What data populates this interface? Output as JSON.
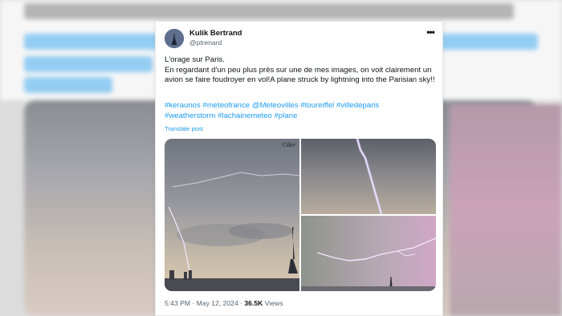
{
  "tweet": {
    "author_name": "Kulik Bertrand",
    "author_handle": "@ptrenard",
    "line1": "L'orage sur Paris.",
    "line2": "En regardant d'un peu plus près sur une de mes images, on voit clairement un avion se faire foudroyer en vol!A plane struck by lightning into the Parisian sky!!",
    "hashtags": [
      "#keraunos",
      "#meteofrance",
      "@Meteovilles",
      "#toureiffel",
      "#villedeparis",
      "#weatherstorm",
      "#lachainemeteo",
      "#plane"
    ],
    "translate_label": "Translate post",
    "photo_watermark": "©Ber",
    "time": "5:43 PM",
    "date": "May 12, 2024",
    "views_count": "36.5K",
    "views_label": "Views",
    "separator": "·"
  },
  "colors": {
    "link": "#1d9bf0",
    "text": "#0f1419",
    "secondary": "#536471"
  },
  "icons": {
    "more": "more-options-icon"
  }
}
